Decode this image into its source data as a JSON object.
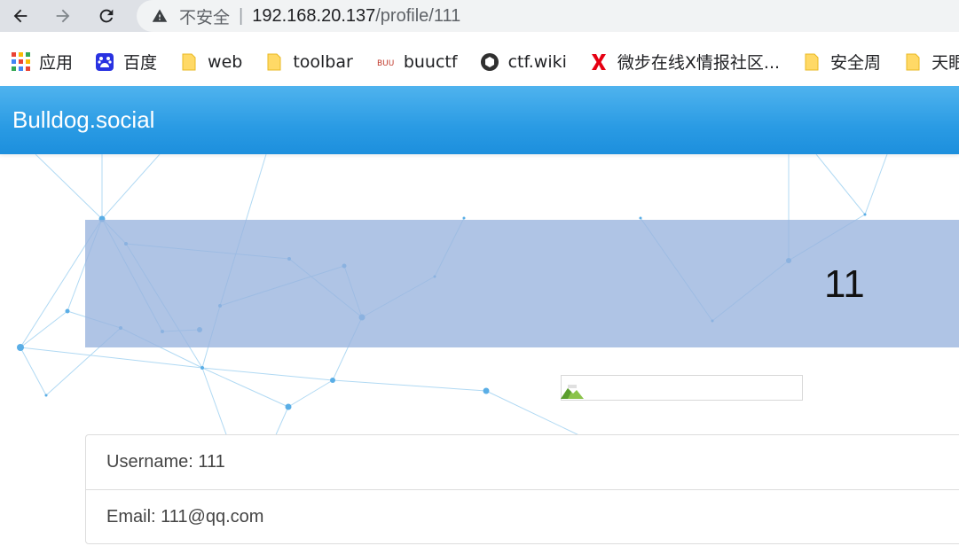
{
  "browser": {
    "insecure_label": "不安全",
    "separator": "|",
    "url_host": "192.168.20.137",
    "url_path": "/profile/111",
    "bookmarks": [
      {
        "label": "应用",
        "icon": "apps-grid-icon"
      },
      {
        "label": "百度",
        "icon": "baidu-icon"
      },
      {
        "label": "web",
        "icon": "folder-icon"
      },
      {
        "label": "toolbar",
        "icon": "folder-icon"
      },
      {
        "label": "buuctf",
        "icon": "buuctf-icon"
      },
      {
        "label": "ctf.wiki",
        "icon": "ctf-wiki-icon"
      },
      {
        "label": "微步在线X情报社区...",
        "icon": "threatbook-x-icon"
      },
      {
        "label": "安全周",
        "icon": "folder-icon"
      },
      {
        "label": "天眼",
        "icon": "folder-icon"
      }
    ]
  },
  "site": {
    "brand": "Bulldog.social"
  },
  "profile": {
    "banner_name": "11",
    "username_line": "Username: 111",
    "email_line": "Email: 111@qq.com"
  },
  "colors": {
    "navbar": "#2a9be4",
    "banner": "#98b4de",
    "network_lines": "#8fc9ee"
  }
}
